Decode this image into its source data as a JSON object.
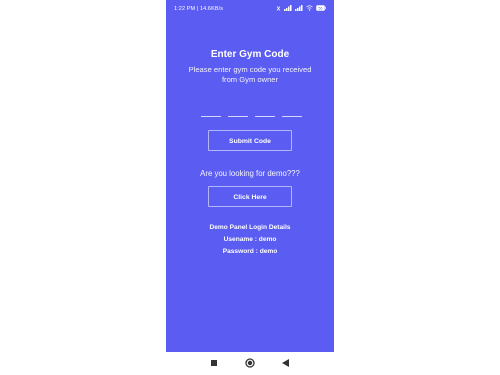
{
  "status_bar": {
    "time": "1:22 PM | 14.6KB/s",
    "battery": "56"
  },
  "main": {
    "title": "Enter Gym Code",
    "subtitle": "Please enter gym code you received from Gym owner",
    "code_fields": [
      "",
      "",
      "",
      ""
    ],
    "submit_label": "Submit Code",
    "demo_question": "Are you looking for demo???",
    "click_label": "Click Here",
    "demo_details_title": "Demo Panel Login Details",
    "username_line": "Usename : demo",
    "password_line": "Password : demo"
  },
  "nav_bar": {
    "icons": [
      "recents-square-icon",
      "home-circle-icon",
      "back-triangle-icon"
    ]
  },
  "colors": {
    "background": "#5a5cf2",
    "text": "#ffffff"
  }
}
